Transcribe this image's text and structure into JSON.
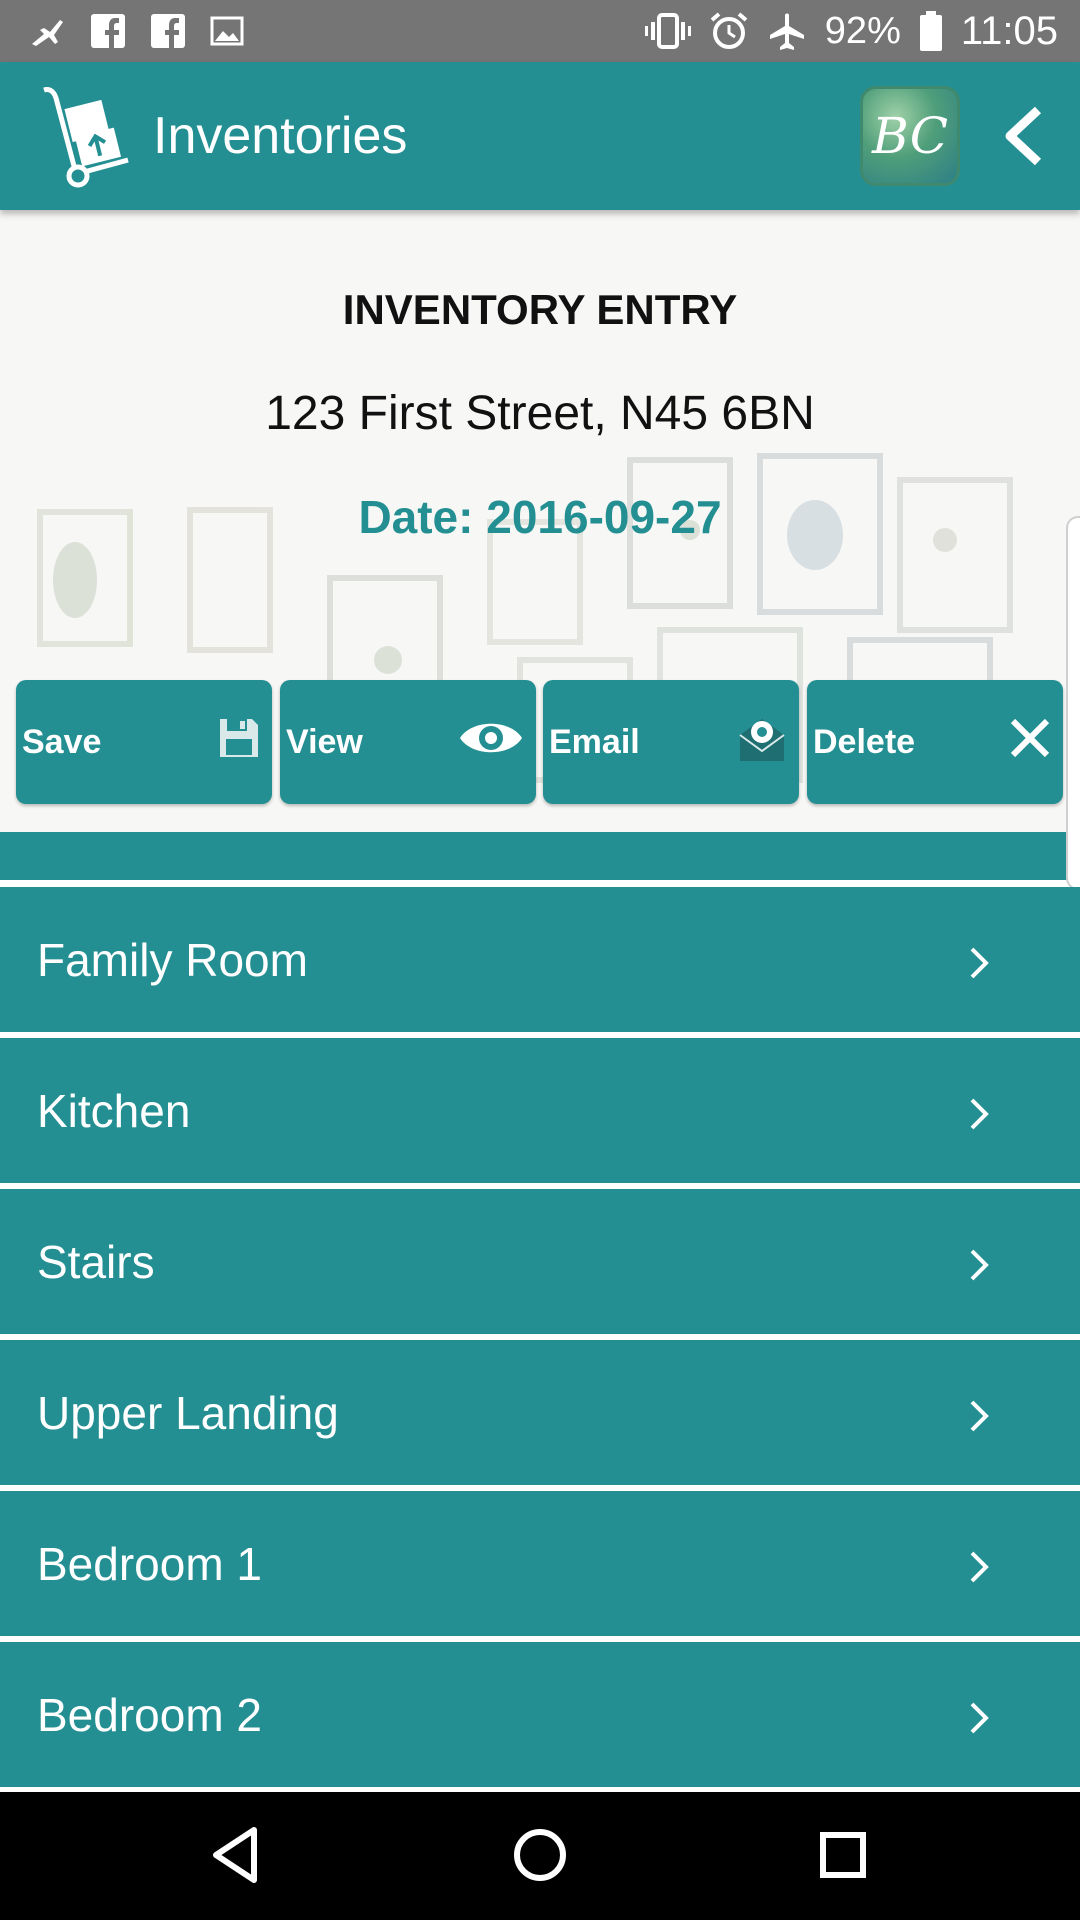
{
  "status_bar": {
    "icons": [
      "airplane-icon",
      "facebook-icon",
      "facebook-icon",
      "image-icon",
      "vibrate-icon",
      "alarm-icon",
      "airplane-mode-icon",
      "battery-icon"
    ],
    "battery": "92%",
    "time": "11:05"
  },
  "app_bar": {
    "title": "Inventories",
    "badge": "BC"
  },
  "header": {
    "title": "INVENTORY ENTRY",
    "address": "123  First Street, N45 6BN",
    "date": "Date: 2016-09-27"
  },
  "actions": [
    {
      "label": "Save",
      "icon": "floppy-disk-icon"
    },
    {
      "label": "View",
      "icon": "eye-icon"
    },
    {
      "label": "Email",
      "icon": "envelope-icon"
    },
    {
      "label": "Delete",
      "icon": "close-icon"
    }
  ],
  "rooms": [
    {
      "label": "Family Room"
    },
    {
      "label": "Kitchen"
    },
    {
      "label": "Stairs"
    },
    {
      "label": "Upper Landing"
    },
    {
      "label": "Bedroom 1"
    },
    {
      "label": "Bedroom 2"
    }
  ],
  "colors": {
    "accent": "#248f92",
    "status_bar": "#757575",
    "nav_bar": "#000000"
  }
}
